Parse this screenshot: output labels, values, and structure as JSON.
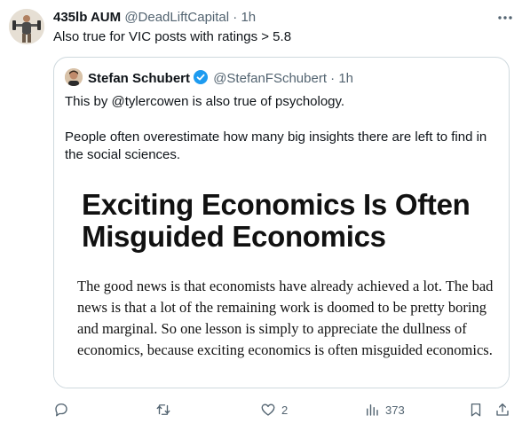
{
  "tweet": {
    "display_name": "435lb AUM",
    "handle": "@DeadLiftCapital",
    "time": "· 1h",
    "text": "Also true for VIC posts with ratings > 5.8"
  },
  "quote": {
    "display_name": "Stefan Schubert",
    "handle": "@StefanFSchubert",
    "time": "· 1h",
    "paragraph1": "This by @tylercowen is also true of psychology.",
    "paragraph2": "People often overestimate how many big insights there are left to find in the social sciences.",
    "article_title": "Exciting Economics Is Often Misguided Economics",
    "article_body": "The good news is that economists have already achieved a lot. The bad news is that a lot of the remaining work is doomed to be pretty boring and marginal. So one lesson is simply to appreciate the dullness of economics, because exciting economics is often misguided economics."
  },
  "actions": {
    "reply_icon": "reply-icon",
    "retweet_icon": "retweet-icon",
    "like_icon": "heart-icon",
    "like_count": "2",
    "views_icon": "analytics-icon",
    "views_count": "373",
    "bookmark_icon": "bookmark-icon",
    "share_icon": "share-icon"
  },
  "colors": {
    "text": "#0f1419",
    "muted": "#536471",
    "border": "#cfd9de",
    "verified": "#1d9bf0"
  }
}
